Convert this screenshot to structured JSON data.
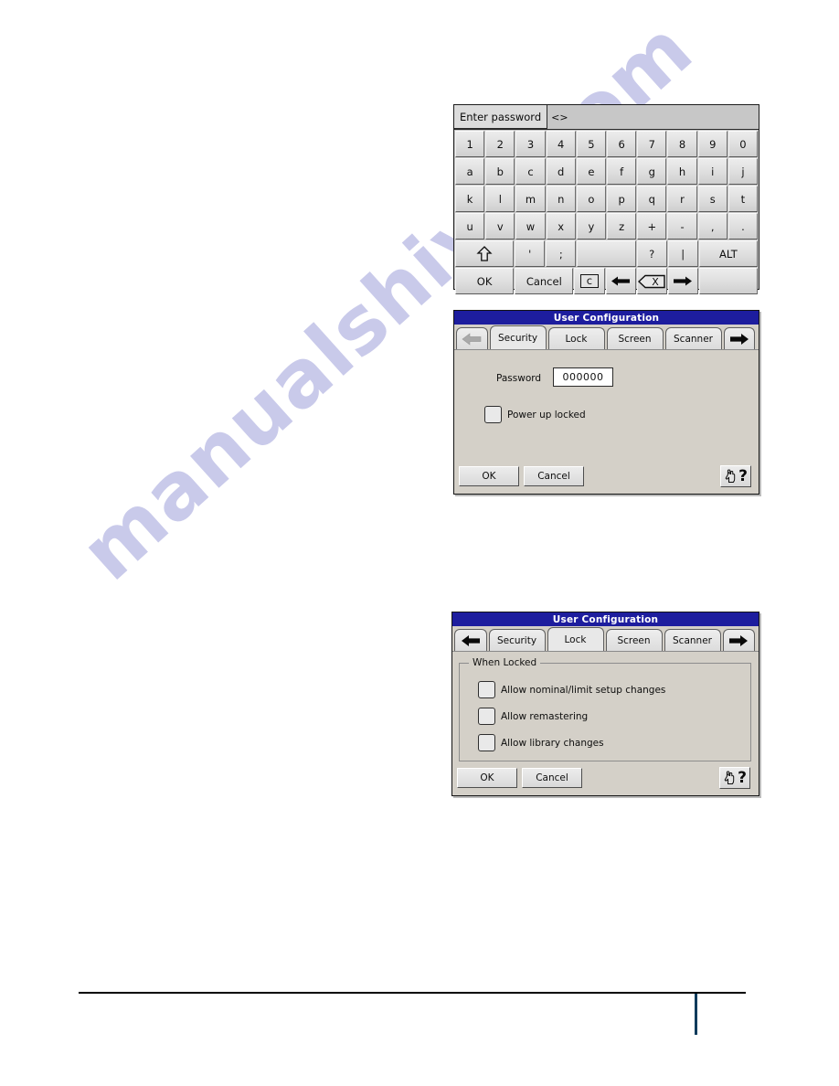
{
  "page": {
    "watermark": "manualshive.com",
    "background_color": "#ffffff"
  },
  "keyboard": {
    "name": "on-screen-keyboard",
    "prompt_label": "Enter password",
    "input_value": "<>",
    "rows": [
      {
        "keys": [
          {
            "label": "1"
          },
          {
            "label": "2"
          },
          {
            "label": "3"
          },
          {
            "label": "4"
          },
          {
            "label": "5"
          },
          {
            "label": "6"
          },
          {
            "label": "7"
          },
          {
            "label": "8"
          },
          {
            "label": "9"
          },
          {
            "label": "0"
          }
        ]
      },
      {
        "keys": [
          {
            "label": "a"
          },
          {
            "label": "b"
          },
          {
            "label": "c"
          },
          {
            "label": "d"
          },
          {
            "label": "e"
          },
          {
            "label": "f"
          },
          {
            "label": "g"
          },
          {
            "label": "h"
          },
          {
            "label": "i"
          },
          {
            "label": "j"
          }
        ]
      },
      {
        "keys": [
          {
            "label": "k"
          },
          {
            "label": "l"
          },
          {
            "label": "m"
          },
          {
            "label": "n"
          },
          {
            "label": "o"
          },
          {
            "label": "p"
          },
          {
            "label": "q"
          },
          {
            "label": "r"
          },
          {
            "label": "s"
          },
          {
            "label": "t"
          }
        ]
      },
      {
        "keys": [
          {
            "label": "u"
          },
          {
            "label": "v"
          },
          {
            "label": "w"
          },
          {
            "label": "x"
          },
          {
            "label": "y"
          },
          {
            "label": "z"
          },
          {
            "label": "+"
          },
          {
            "label": "-"
          },
          {
            "label": ","
          },
          {
            "label": "."
          }
        ]
      },
      {
        "keys": [
          {
            "label": "shift",
            "icon": "shift-up-arrow-icon",
            "width": 2
          },
          {
            "label": "'"
          },
          {
            "label": ";"
          },
          {
            "label": "space",
            "icon": "space-bar",
            "width": 2
          },
          {
            "label": "?"
          },
          {
            "label": "|"
          },
          {
            "label": "ALT",
            "width": 2
          }
        ]
      },
      {
        "keys": [
          {
            "label": "OK",
            "width": 2
          },
          {
            "label": "Cancel",
            "width": 2
          },
          {
            "label": "c",
            "icon": "clear-key"
          },
          {
            "label": "left",
            "icon": "arrow-left-icon"
          },
          {
            "label": "backspace",
            "icon": "backspace-icon"
          },
          {
            "label": "right",
            "icon": "arrow-right-icon"
          },
          {
            "label": "",
            "width": 2
          }
        ]
      }
    ]
  },
  "dialog_security": {
    "title": "User Configuration",
    "tabs": [
      {
        "label": "Security",
        "active": true
      },
      {
        "label": "Lock",
        "active": false
      },
      {
        "label": "Screen",
        "active": false
      },
      {
        "label": "Scanner",
        "active": false
      }
    ],
    "nav_prev_icon": "arrow-left-icon",
    "nav_next_icon": "arrow-right-icon",
    "nav_prev_disabled": true,
    "password_label": "Password",
    "password_value": "000000",
    "power_up_locked_label": "Power up locked",
    "power_up_locked_checked": false,
    "ok_label": "OK",
    "cancel_label": "Cancel",
    "help_icon": "hand-pointer-help-icon",
    "help_glyph": "?",
    "title_bar_color": "#1d1d9e",
    "face_color": "#d4d0c8"
  },
  "dialog_lock": {
    "title": "User Configuration",
    "tabs": [
      {
        "label": "Security",
        "active": false
      },
      {
        "label": "Lock",
        "active": true
      },
      {
        "label": "Screen",
        "active": false
      },
      {
        "label": "Scanner",
        "active": false
      }
    ],
    "nav_prev_icon": "arrow-left-icon",
    "nav_next_icon": "arrow-right-icon",
    "nav_prev_disabled": false,
    "group_label": "When Locked",
    "checkboxes": [
      {
        "label": "Allow nominal/limit setup changes",
        "checked": false
      },
      {
        "label": "Allow remastering",
        "checked": false
      },
      {
        "label": "Allow library changes",
        "checked": false
      }
    ],
    "ok_label": "OK",
    "cancel_label": "Cancel",
    "help_icon": "hand-pointer-help-icon",
    "help_glyph": "?",
    "title_bar_color": "#1d1d9e",
    "face_color": "#d4d0c8"
  },
  "footer": {
    "rule_color": "#000000",
    "tick_color": "#0c3b5c"
  }
}
